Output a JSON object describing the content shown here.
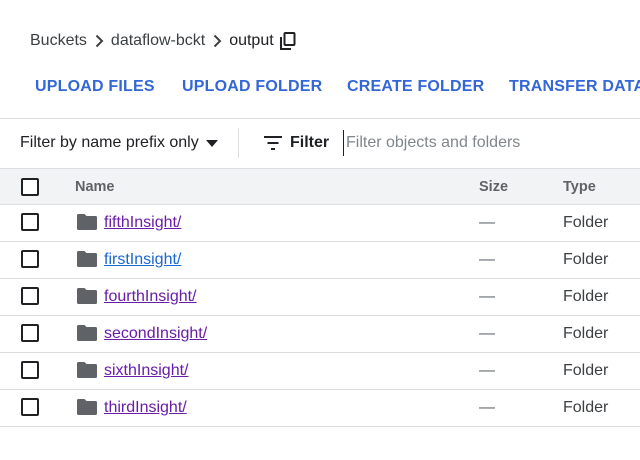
{
  "breadcrumb": {
    "items": [
      "Buckets",
      "dataflow-bckt"
    ],
    "current": "output",
    "separator_icon": "chevron-right-icon",
    "copy_icon": "copy-icon"
  },
  "actions": {
    "upload_files": "UPLOAD FILES",
    "upload_folder": "UPLOAD FOLDER",
    "create_folder": "CREATE FOLDER",
    "transfer_data": "TRANSFER DATA"
  },
  "filter": {
    "prefix_label": "Filter by name prefix only",
    "button_label": "Filter",
    "placeholder": "Filter objects and folders",
    "value": ""
  },
  "table": {
    "columns": [
      "Name",
      "Size",
      "Type"
    ],
    "rows": [
      {
        "name": "fifthInsight/",
        "size": "—",
        "type": "Folder",
        "visited": true
      },
      {
        "name": "firstInsight/",
        "size": "—",
        "type": "Folder",
        "visited": false
      },
      {
        "name": "fourthInsight/",
        "size": "—",
        "type": "Folder",
        "visited": true
      },
      {
        "name": "secondInsight/",
        "size": "—",
        "type": "Folder",
        "visited": true
      },
      {
        "name": "sixthInsight/",
        "size": "—",
        "type": "Folder",
        "visited": true
      },
      {
        "name": "thirdInsight/",
        "size": "—",
        "type": "Folder",
        "visited": true
      }
    ]
  },
  "colors": {
    "action_blue": "#3367d6",
    "link_visited": "#681da8",
    "link_unvisited": "#1967d2",
    "header_bg": "#f1f3f4",
    "divider": "#dadce0"
  }
}
